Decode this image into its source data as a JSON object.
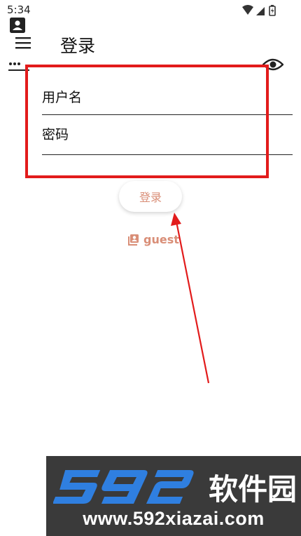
{
  "status_bar": {
    "time": "5:34"
  },
  "app_bar": {
    "title": "登录",
    "menu_icon": "menu-icon"
  },
  "form": {
    "username_placeholder": "用户名",
    "password_placeholder": "密码",
    "username_icon": "account-box-icon",
    "password_icon": "password-dots-icon",
    "visibility_icon": "eye-icon"
  },
  "login_button": {
    "label": "登录"
  },
  "guest": {
    "label": "guest",
    "icon": "contacts-icon"
  },
  "annotation": {
    "color": "#e21b1b"
  },
  "watermark": {
    "brand": "592软件园",
    "url": "www.592xiazai.com"
  },
  "colors": {
    "accent": "#d98e77",
    "highlight": "#e21b1b"
  }
}
